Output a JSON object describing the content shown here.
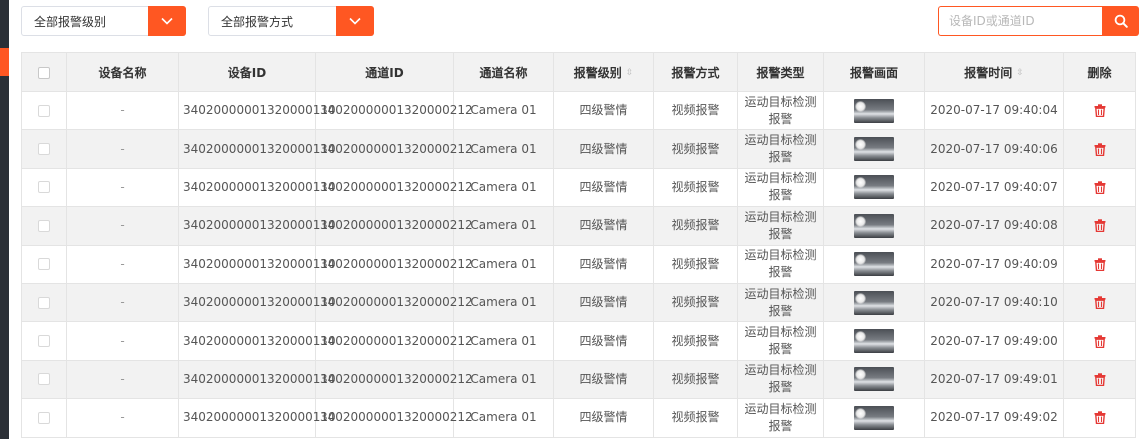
{
  "filters": {
    "level_select": "全部报警级别",
    "method_select": "全部报警方式"
  },
  "search": {
    "placeholder": "设备ID或通道ID",
    "value": ""
  },
  "colors": {
    "accent": "#ff5722",
    "delete": "#e53935",
    "header_bg": "#f2f2f2",
    "sidebar": "#2b2f36"
  },
  "table": {
    "headers": {
      "device_name": "设备名称",
      "device_id": "设备ID",
      "channel_id": "通道ID",
      "channel_name": "通道名称",
      "alarm_level": "报警级别",
      "alarm_method": "报警方式",
      "alarm_type": "报警类型",
      "alarm_image": "报警画面",
      "alarm_time": "报警时间",
      "delete": "删除"
    },
    "rows": [
      {
        "device_name": "-",
        "device_id": "34020000001320000110",
        "channel_id": "34020000001320000212",
        "channel_name": "Camera 01",
        "alarm_level": "四级警情",
        "alarm_method": "视频报警",
        "alarm_type": "运动目标检测报警",
        "alarm_time": "2020-07-17 09:40:04"
      },
      {
        "device_name": "-",
        "device_id": "34020000001320000110",
        "channel_id": "34020000001320000212",
        "channel_name": "Camera 01",
        "alarm_level": "四级警情",
        "alarm_method": "视频报警",
        "alarm_type": "运动目标检测报警",
        "alarm_time": "2020-07-17 09:40:06"
      },
      {
        "device_name": "-",
        "device_id": "34020000001320000110",
        "channel_id": "34020000001320000212",
        "channel_name": "Camera 01",
        "alarm_level": "四级警情",
        "alarm_method": "视频报警",
        "alarm_type": "运动目标检测报警",
        "alarm_time": "2020-07-17 09:40:07"
      },
      {
        "device_name": "-",
        "device_id": "34020000001320000110",
        "channel_id": "34020000001320000212",
        "channel_name": "Camera 01",
        "alarm_level": "四级警情",
        "alarm_method": "视频报警",
        "alarm_type": "运动目标检测报警",
        "alarm_time": "2020-07-17 09:40:08"
      },
      {
        "device_name": "-",
        "device_id": "34020000001320000110",
        "channel_id": "34020000001320000212",
        "channel_name": "Camera 01",
        "alarm_level": "四级警情",
        "alarm_method": "视频报警",
        "alarm_type": "运动目标检测报警",
        "alarm_time": "2020-07-17 09:40:09"
      },
      {
        "device_name": "-",
        "device_id": "34020000001320000110",
        "channel_id": "34020000001320000212",
        "channel_name": "Camera 01",
        "alarm_level": "四级警情",
        "alarm_method": "视频报警",
        "alarm_type": "运动目标检测报警",
        "alarm_time": "2020-07-17 09:40:10"
      },
      {
        "device_name": "-",
        "device_id": "34020000001320000110",
        "channel_id": "34020000001320000212",
        "channel_name": "Camera 01",
        "alarm_level": "四级警情",
        "alarm_method": "视频报警",
        "alarm_type": "运动目标检测报警",
        "alarm_time": "2020-07-17 09:49:00"
      },
      {
        "device_name": "-",
        "device_id": "34020000001320000110",
        "channel_id": "34020000001320000212",
        "channel_name": "Camera 01",
        "alarm_level": "四级警情",
        "alarm_method": "视频报警",
        "alarm_type": "运动目标检测报警",
        "alarm_time": "2020-07-17 09:49:01"
      },
      {
        "device_name": "-",
        "device_id": "34020000001320000110",
        "channel_id": "34020000001320000212",
        "channel_name": "Camera 01",
        "alarm_level": "四级警情",
        "alarm_method": "视频报警",
        "alarm_type": "运动目标检测报警",
        "alarm_time": "2020-07-17 09:49:02"
      }
    ]
  }
}
